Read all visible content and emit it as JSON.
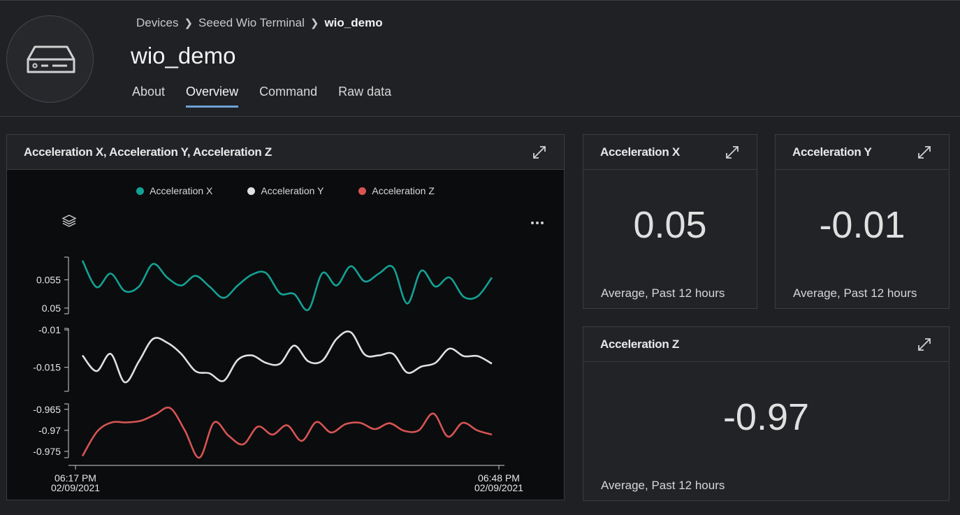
{
  "breadcrumb": {
    "items": [
      "Devices",
      "Seeed Wio Terminal"
    ],
    "current": "wio_demo"
  },
  "page_title": "wio_demo",
  "tabs": [
    {
      "label": "About",
      "active": false
    },
    {
      "label": "Overview",
      "active": true
    },
    {
      "label": "Command",
      "active": false
    },
    {
      "label": "Raw data",
      "active": false
    }
  ],
  "main_chart": {
    "title": "Acceleration X, Acceleration Y, Acceleration Z",
    "legend": [
      {
        "label": "Acceleration X",
        "color": "#13a195"
      },
      {
        "label": "Acceleration Y",
        "color": "#e0e0e0"
      },
      {
        "label": "Acceleration Z",
        "color": "#d65454"
      }
    ],
    "x_start": {
      "time": "06:17 PM",
      "date": "02/09/2021"
    },
    "x_end": {
      "time": "06:48 PM",
      "date": "02/09/2021"
    },
    "stack_icon": "layers-icon",
    "more_icon": "more-icon"
  },
  "kpis": {
    "x": {
      "title": "Acceleration X",
      "value": "0.05",
      "footer": "Average, Past 12 hours"
    },
    "y": {
      "title": "Acceleration Y",
      "value": "-0.01",
      "footer": "Average, Past 12 hours"
    },
    "z": {
      "title": "Acceleration Z",
      "value": "-0.97",
      "footer": "Average, Past 12 hours"
    }
  },
  "chart_data": {
    "type": "line",
    "x": [
      "06:17 PM 02/09/2021",
      "06:48 PM 02/09/2021"
    ],
    "panels": [
      {
        "name": "Acceleration X",
        "color": "#13a195",
        "yticks": [
          0.055,
          0.05
        ],
        "ylim": [
          0.049,
          0.059
        ],
        "values": [
          0.0584,
          0.0537,
          0.0561,
          0.053,
          0.0538,
          0.0578,
          0.0554,
          0.054,
          0.0557,
          0.0538,
          0.0518,
          0.054,
          0.0559,
          0.0562,
          0.0526,
          0.0525,
          0.0497,
          0.0562,
          0.054,
          0.0574,
          0.0547,
          0.0561,
          0.0572,
          0.0508,
          0.0566,
          0.0538,
          0.0554,
          0.052,
          0.0521,
          0.0554
        ]
      },
      {
        "name": "Acceleration Y",
        "color": "#e0e0e0",
        "yticks": [
          -0.01,
          -0.015
        ],
        "ylim": [
          -0.0182,
          -0.0098
        ],
        "values": [
          -0.0134,
          -0.0155,
          -0.0132,
          -0.017,
          -0.0142,
          -0.0112,
          -0.0117,
          -0.0132,
          -0.0155,
          -0.0158,
          -0.0168,
          -0.014,
          -0.0134,
          -0.0144,
          -0.0145,
          -0.0121,
          -0.0142,
          -0.0141,
          -0.0112,
          -0.0103,
          -0.0133,
          -0.0134,
          -0.0132,
          -0.0157,
          -0.0149,
          -0.0144,
          -0.0125,
          -0.0135,
          -0.0135,
          -0.0145
        ]
      },
      {
        "name": "Acceleration Z",
        "color": "#d65454",
        "yticks": [
          -0.965,
          -0.97,
          -0.975
        ],
        "ylim": [
          -0.9765,
          -0.9637
        ],
        "values": [
          -0.9761,
          -0.9703,
          -0.9681,
          -0.9681,
          -0.9677,
          -0.9662,
          -0.9647,
          -0.97,
          -0.9765,
          -0.9681,
          -0.9713,
          -0.9733,
          -0.9691,
          -0.971,
          -0.9688,
          -0.9725,
          -0.968,
          -0.9705,
          -0.9685,
          -0.9682,
          -0.9697,
          -0.9683,
          -0.9701,
          -0.97,
          -0.966,
          -0.9715,
          -0.9682,
          -0.97,
          -0.971
        ]
      }
    ]
  }
}
